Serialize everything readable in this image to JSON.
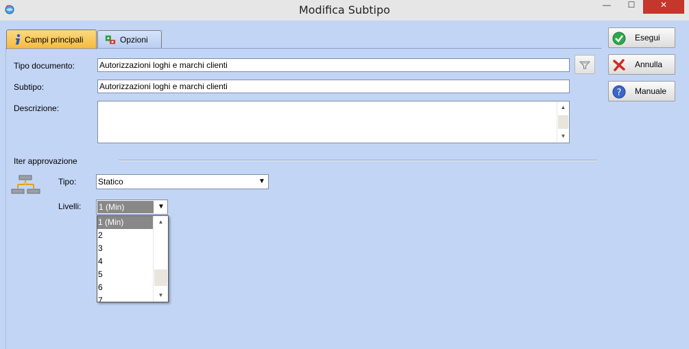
{
  "window": {
    "title": "Modifica Subtipo",
    "app_icon": "globe-app-icon",
    "controls": {
      "minimize": "—",
      "maximize": "☐",
      "close": "✕"
    }
  },
  "tabs": [
    {
      "label": "Campi principali",
      "icon": "info-icon",
      "active": true
    },
    {
      "label": "Opzioni",
      "icon": "options-icon",
      "active": false
    }
  ],
  "form": {
    "tipo_documento": {
      "label": "Tipo documento:",
      "value": "Autorizzazioni loghi e marchi clienti"
    },
    "subtipo": {
      "label": "Subtipo:",
      "value": "Autorizzazioni loghi e marchi clienti"
    },
    "descrizione": {
      "label": "Descrizione:",
      "value": ""
    },
    "iter": {
      "section_label": "Iter approvazione",
      "tipo": {
        "label": "Tipo:",
        "value": "Statico"
      },
      "livelli": {
        "label": "Livelli:",
        "value": "1 (Min)",
        "options": [
          "1 (Min)",
          "2",
          "3",
          "4",
          "5",
          "6",
          "7"
        ]
      }
    }
  },
  "buttons": {
    "esegui": {
      "label": "Esegui",
      "icon": "check-icon"
    },
    "annulla": {
      "label": "Annulla",
      "icon": "cancel-icon"
    },
    "manuale": {
      "label": "Manuale",
      "icon": "help-icon"
    }
  },
  "colors": {
    "background": "#c3d5f5",
    "tab_active": "#f6b93a",
    "close_button": "#c5362c",
    "selected_option": "#888888"
  }
}
